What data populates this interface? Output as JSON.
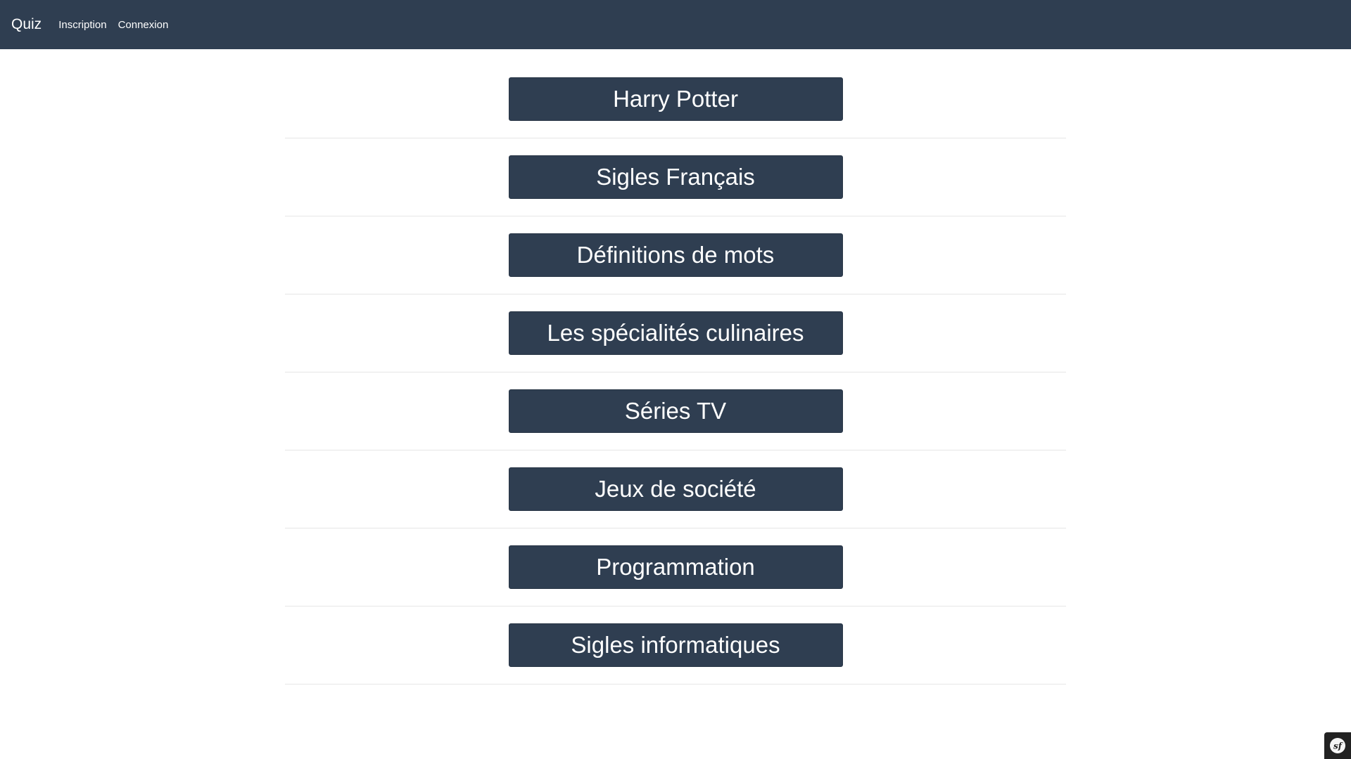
{
  "navbar": {
    "brand": "Quiz",
    "links": [
      "Inscription",
      "Connexion"
    ],
    "background": "#2f3e51"
  },
  "quizzes": [
    "Harry Potter",
    "Sigles Français",
    "Définitions de mots",
    "Les spécialités culinaires",
    "Séries TV",
    "Jeux de société",
    "Programmation",
    "Sigles informatiques"
  ],
  "colors": {
    "button": "#2f3e51",
    "divider": "#e6e6e6",
    "toolbar": "#222222"
  },
  "icons": {
    "debug_toolbar": "symfony-logo-icon"
  }
}
